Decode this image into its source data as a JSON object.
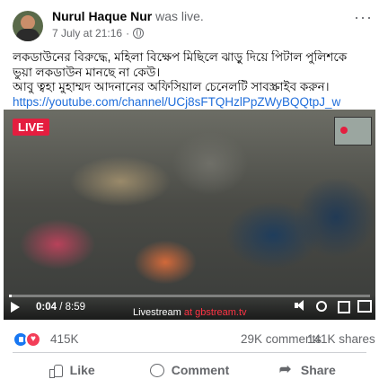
{
  "post": {
    "author": "Nurul Haque Nur",
    "action": "was live.",
    "timestamp": "7 July at 21:16",
    "dot": "·",
    "more_icon": "more-horizontal-icon",
    "text_lines": [
      "লকডাউনের বিরুদ্ধে, মহিলা বিক্ষেপ মিছিলে  ঝাড়ু দিয়ে পিটাল পুলিশকে",
      "ভুয়া লকডাউন মানছে না কেউ।",
      "আবু ত্বহা মুহাম্মদ আদনানের অফিসিয়াল চেনেলটি সাবস্ক্রাইব করুন।"
    ],
    "link": "https://youtube.com/channel/UCj8sFTQHzlPpZWyBQQtpJ_w"
  },
  "video": {
    "live_label": "LIVE",
    "current_time": "0:04",
    "separator": " / ",
    "duration": "8:59",
    "progress": 0.007,
    "watermark_a": "Livestream",
    "watermark_b": " at gbstream.tv"
  },
  "stats": {
    "reaction_count": "415K",
    "comments": "29K comments",
    "shares": "141K shares"
  },
  "actions": {
    "like": "Like",
    "comment": "Comment",
    "share": "Share"
  },
  "colors": {
    "like_blue": "#1877f2",
    "love_red": "#f33e58",
    "live_red": "#e41e3f",
    "link_blue": "#216fdb"
  }
}
